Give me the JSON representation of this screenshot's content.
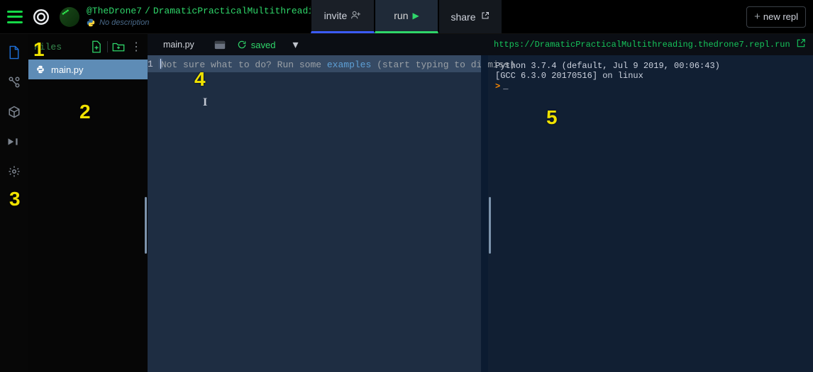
{
  "header": {
    "user": "@TheDrone7",
    "sep": "/",
    "project": "DramaticPracticalMultithreading",
    "description": "No description",
    "invite_label": "invite",
    "run_label": "run",
    "share_label": "share",
    "newrepl_label": "new repl",
    "newrepl_plus": "+",
    "language": "python"
  },
  "sidebar": {
    "panel_title": "Files",
    "files": [
      {
        "name": "main.py"
      }
    ]
  },
  "editor": {
    "tab": "main.py",
    "saved_label": "saved",
    "line_number": "1",
    "hint_pre": "Not sure what to do? Run some ",
    "hint_link": "examples",
    "hint_post": " (start typing to dismiss)"
  },
  "console": {
    "url": "https://DramaticPracticalMultithreading.thedrone7.repl.run",
    "line1": "Python 3.7.4 (default, Jul  9 2019, 00:06:43)",
    "line2": "[GCC 6.3.0 20170516] on linux",
    "prompt": ">",
    "cursor": "_"
  },
  "icons": {
    "hamburger": "hamburger",
    "logo": "replit-spiral",
    "avatar": "user-avatar",
    "pencil": "✎",
    "py": "python-logo",
    "invite": "person-plus",
    "run": "play",
    "share": "share-arrow",
    "file": "file",
    "vcs": "branch",
    "package": "cube",
    "debug": "play-stop",
    "settings": "gear",
    "newfile": "file-plus",
    "newfolder": "folder-plus",
    "more": "⋮",
    "card": "card",
    "reload": "reload",
    "chev": "▾",
    "external": "external-link",
    "term_in": "terminal-in",
    "term_del": "delete"
  },
  "annotations": {
    "a1": "1",
    "a2": "2",
    "a3": "3",
    "a4": "4",
    "a5": "5"
  },
  "colors": {
    "accent_green": "#2fd66a",
    "active_blue": "#1e6fd8",
    "selected_file_bg": "#5e8cb6",
    "editor_bg": "#1e2d42",
    "console_bg": "#111f33",
    "anno_yellow": "#f0e200"
  }
}
